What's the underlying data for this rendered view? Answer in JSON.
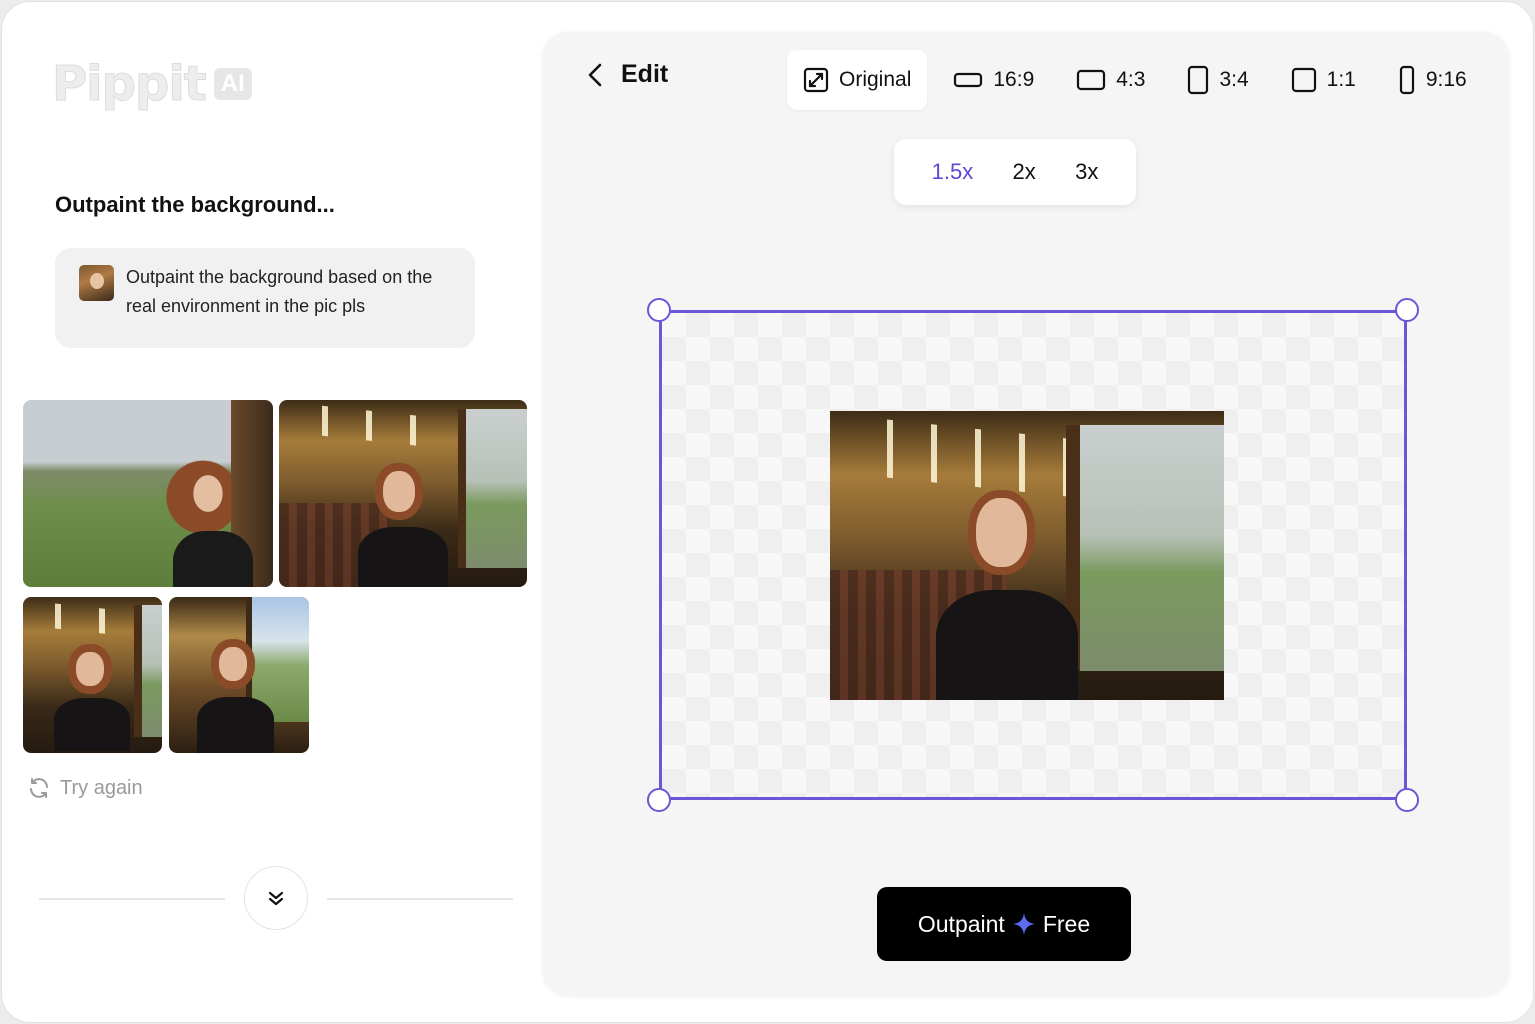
{
  "brand": {
    "wordmark": "Pippit",
    "badge": "AI"
  },
  "chat": {
    "title": "Outpaint the background...",
    "prompt": "Outpaint the background based on the real environment in the pic pls",
    "try_again_label": "Try again"
  },
  "editor": {
    "back_label": "Edit",
    "ratios": [
      {
        "label": "Original",
        "icon": "expand-icon",
        "active": true
      },
      {
        "label": "16:9",
        "icon": "ratio-16-9-icon"
      },
      {
        "label": "4:3",
        "icon": "ratio-4-3-icon"
      },
      {
        "label": "3:4",
        "icon": "ratio-3-4-icon"
      },
      {
        "label": "1:1",
        "icon": "ratio-1-1-icon"
      },
      {
        "label": "9:16",
        "icon": "ratio-9-16-icon"
      }
    ],
    "scales": [
      {
        "label": "1.5x",
        "active": true
      },
      {
        "label": "2x"
      },
      {
        "label": "3x"
      }
    ],
    "outpaint_button": {
      "label": "Outpaint",
      "suffix": "Free",
      "icon": "sparkle-icon"
    }
  },
  "colors": {
    "accent": "#6a57d6",
    "active_scale": "#5b4ad6",
    "button_bg": "#000000"
  }
}
